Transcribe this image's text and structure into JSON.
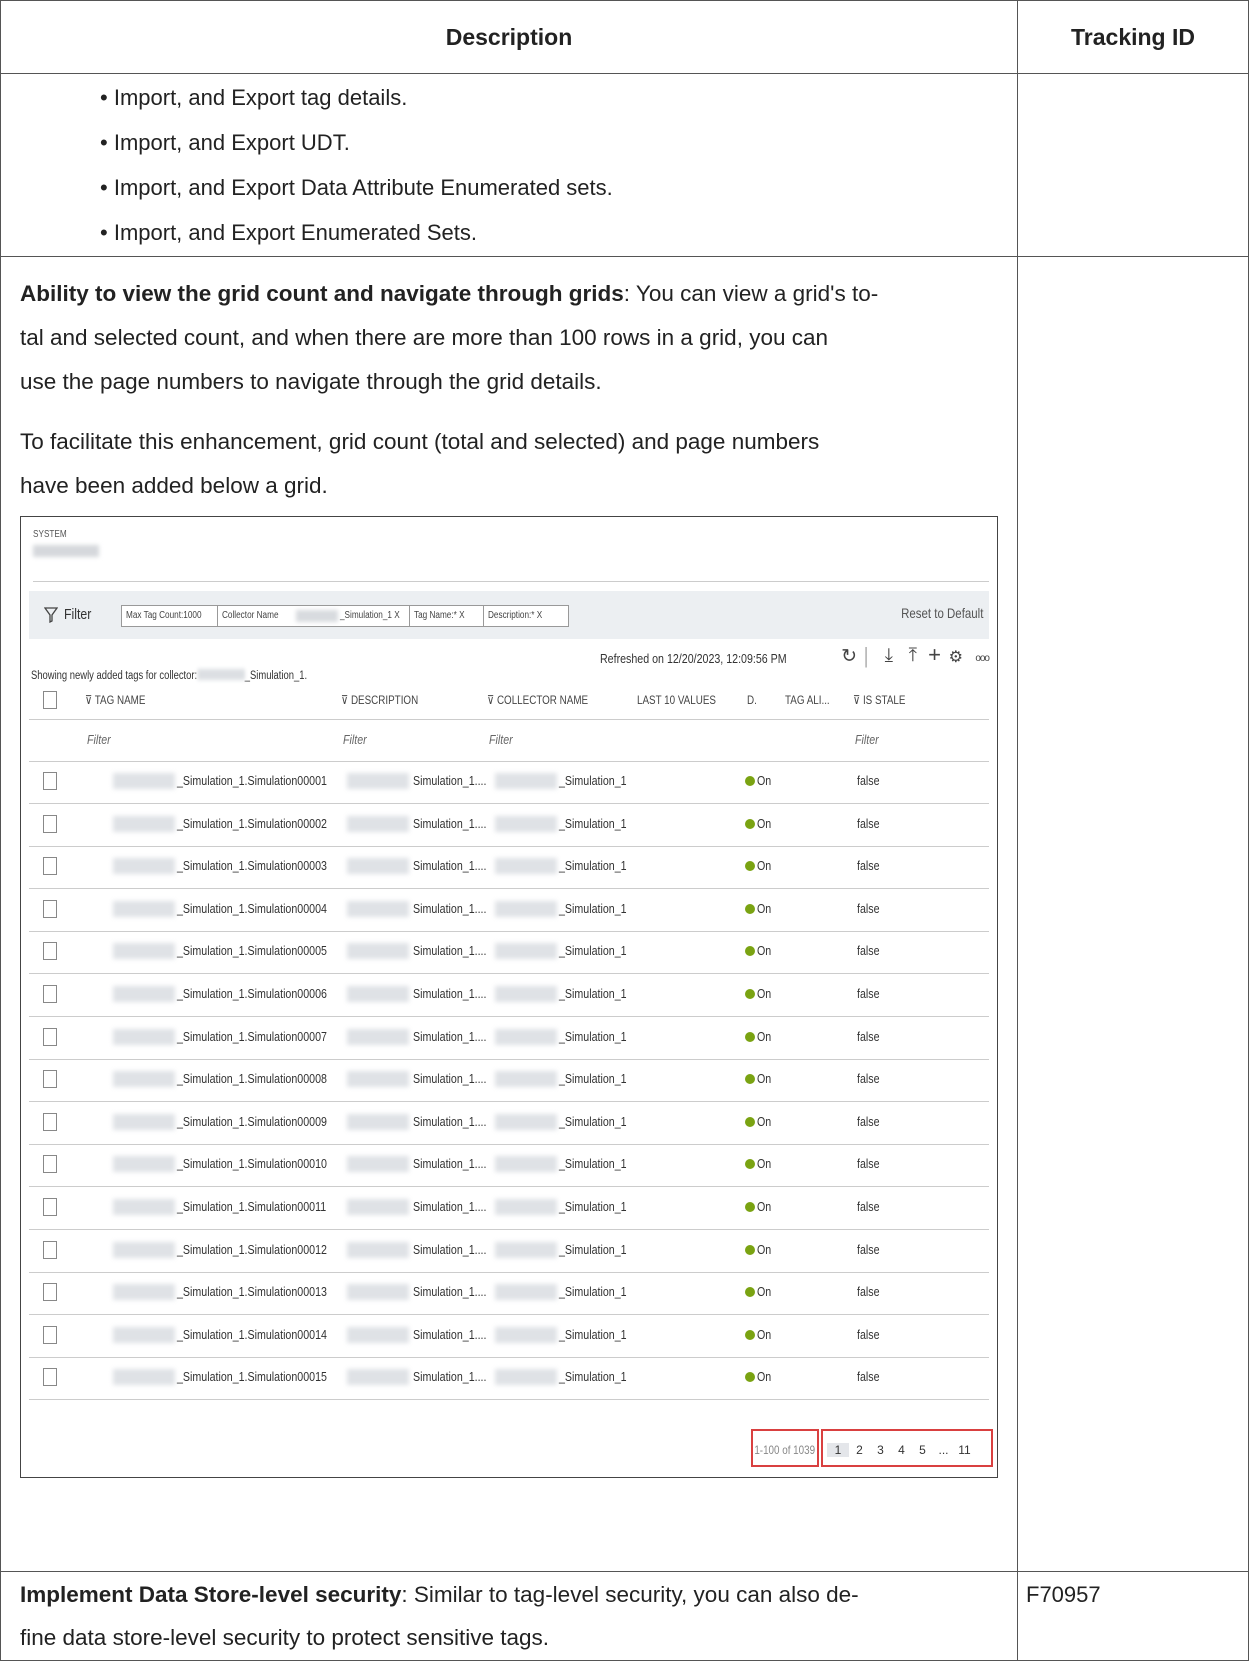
{
  "table": {
    "header_description": "Description",
    "header_tracking": "Tracking ID"
  },
  "bullets": [
    "Import, and Export tag details.",
    "Import, and Export UDT.",
    "Import, and Export Data Attribute Enumerated sets.",
    "Import, and Export Enumerated Sets."
  ],
  "grid_section": {
    "title": "Ability to view the grid count and navigate through grids",
    "line1_rest": ": You can view a grid's to-",
    "line2": "tal and selected count, and when there are more than 100 rows in a grid, you can",
    "line3": "use the page numbers to navigate through the grid details.",
    "para2_line1": "To facilitate this enhancement, grid count (total and selected) and page numbers",
    "para2_line2": "have been added below a grid."
  },
  "screenshot": {
    "system_label": "SYSTEM",
    "filter_label": "Filter",
    "chips": [
      "Max Tag Count:1000",
      "Collector Name",
      "_Simulation_1 X",
      "Tag Name:* X",
      "Description:* X"
    ],
    "reset": "Reset to Default",
    "showing_prefix": "Showing newly added tags for collector:",
    "showing_suffix": "_Simulation_1.",
    "refreshed": "Refreshed on 12/20/2023, 12:09:56 PM",
    "columns": [
      "TAG NAME",
      "DESCRIPTION",
      "COLLECTOR NAME",
      "LAST 10 VALUES",
      "D.",
      "TAG ALI...",
      "IS STALE"
    ],
    "filter_placeholder": "Filter",
    "rows": [
      {
        "tag": "_Simulation_1.Simulation00001",
        "desc": "Simulation_1....",
        "collector": "_Simulation_1",
        "d": "On",
        "stale": "false"
      },
      {
        "tag": "_Simulation_1.Simulation00002",
        "desc": "Simulation_1....",
        "collector": "_Simulation_1",
        "d": "On",
        "stale": "false"
      },
      {
        "tag": "_Simulation_1.Simulation00003",
        "desc": "Simulation_1....",
        "collector": "_Simulation_1",
        "d": "On",
        "stale": "false"
      },
      {
        "tag": "_Simulation_1.Simulation00004",
        "desc": "Simulation_1....",
        "collector": "_Simulation_1",
        "d": "On",
        "stale": "false"
      },
      {
        "tag": "_Simulation_1.Simulation00005",
        "desc": "Simulation_1....",
        "collector": "_Simulation_1",
        "d": "On",
        "stale": "false"
      },
      {
        "tag": "_Simulation_1.Simulation00006",
        "desc": "Simulation_1....",
        "collector": "_Simulation_1",
        "d": "On",
        "stale": "false"
      },
      {
        "tag": "_Simulation_1.Simulation00007",
        "desc": "Simulation_1....",
        "collector": "_Simulation_1",
        "d": "On",
        "stale": "false"
      },
      {
        "tag": "_Simulation_1.Simulation00008",
        "desc": "Simulation_1....",
        "collector": "_Simulation_1",
        "d": "On",
        "stale": "false"
      },
      {
        "tag": "_Simulation_1.Simulation00009",
        "desc": "Simulation_1....",
        "collector": "_Simulation_1",
        "d": "On",
        "stale": "false"
      },
      {
        "tag": "_Simulation_1.Simulation00010",
        "desc": "Simulation_1....",
        "collector": "_Simulation_1",
        "d": "On",
        "stale": "false"
      },
      {
        "tag": "_Simulation_1.Simulation00011",
        "desc": "Simulation_1....",
        "collector": "_Simulation_1",
        "d": "On",
        "stale": "false"
      },
      {
        "tag": "_Simulation_1.Simulation00012",
        "desc": "Simulation_1....",
        "collector": "_Simulation_1",
        "d": "On",
        "stale": "false"
      },
      {
        "tag": "_Simulation_1.Simulation00013",
        "desc": "Simulation_1....",
        "collector": "_Simulation_1",
        "d": "On",
        "stale": "false"
      },
      {
        "tag": "_Simulation_1.Simulation00014",
        "desc": "Simulation_1....",
        "collector": "_Simulation_1",
        "d": "On",
        "stale": "false"
      },
      {
        "tag": "_Simulation_1.Simulation00015",
        "desc": "Simulation_1....",
        "collector": "_Simulation_1",
        "d": "On",
        "stale": "false"
      }
    ],
    "count": "1-100 of 1039",
    "pages": [
      "1",
      "2",
      "3",
      "4",
      "5",
      "...",
      "11"
    ],
    "highlight_color": "#d94040",
    "status_color": "#7aa312"
  },
  "security": {
    "title": "Implement Data Store-level security",
    "line1_rest": ": Similar to tag-level security, you can also de-",
    "line2": "fine data store-level security to protect sensitive tags.",
    "tracking_id": "F70957"
  }
}
